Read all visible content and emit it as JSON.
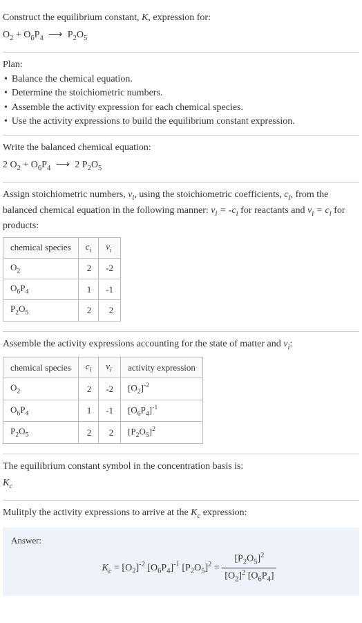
{
  "intro": {
    "line1_a": "Construct the equilibrium constant, ",
    "line1_b": ", expression for:"
  },
  "plan": {
    "heading": "Plan:",
    "items": [
      "Balance the chemical equation.",
      "Determine the stoichiometric numbers.",
      "Assemble the activity expression for each chemical species.",
      "Use the activity expressions to build the equilibrium constant expression."
    ]
  },
  "balanced_heading": "Write the balanced chemical equation:",
  "stoich_text_a": "Assign stoichiometric numbers, ",
  "stoich_text_b": ", using the stoichiometric coefficients, ",
  "stoich_text_c": ", from the balanced chemical equation in the following manner: ",
  "stoich_text_d": " for reactants and ",
  "stoich_text_e": " for products:",
  "table1": {
    "headers": [
      "chemical species",
      "cᵢ",
      "νᵢ"
    ],
    "rows": [
      {
        "species": "O2",
        "c": "2",
        "v": "-2"
      },
      {
        "species": "O6P4",
        "c": "1",
        "v": "-1"
      },
      {
        "species": "P2O5",
        "c": "2",
        "v": "2"
      }
    ]
  },
  "assemble_text": "Assemble the activity expressions accounting for the state of matter and ",
  "table2": {
    "headers": [
      "chemical species",
      "cᵢ",
      "νᵢ",
      "activity expression"
    ],
    "rows": [
      {
        "species": "O2",
        "c": "2",
        "v": "-2",
        "act_base": "O2",
        "act_exp": "-2"
      },
      {
        "species": "O6P4",
        "c": "1",
        "v": "-1",
        "act_base": "O6P4",
        "act_exp": "-1"
      },
      {
        "species": "P2O5",
        "c": "2",
        "v": "2",
        "act_base": "P2O5",
        "act_exp": "2"
      }
    ]
  },
  "kc_symbol_text": "The equilibrium constant symbol in the concentration basis is:",
  "multiply_text_a": "Mulitply the activity expressions to arrive at the ",
  "multiply_text_b": " expression:",
  "answer_label": "Answer:"
}
